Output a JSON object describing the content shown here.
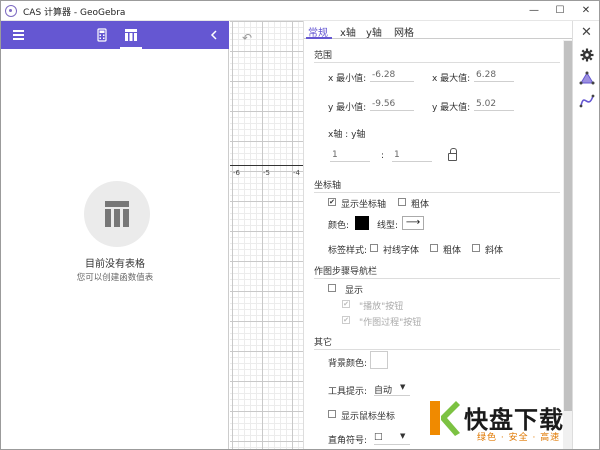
{
  "window": {
    "title": "CAS 计算器 - GeoGebra",
    "minimize_glyph": "—",
    "maximize_glyph": "☐",
    "close_glyph": "✕"
  },
  "left_toolbar": {
    "icons": [
      "menu-icon",
      "calculator-icon",
      "table-icon",
      "chevron-left-icon"
    ],
    "background_color": "#6557d2"
  },
  "table_view": {
    "empty_title": "目前没有表格",
    "empty_subtitle": "您可以创建函数值表"
  },
  "graphics": {
    "undo_glyph": "↶",
    "tick_labels": [
      "-6",
      "-5",
      "-4"
    ]
  },
  "settings": {
    "tabs": [
      "常规",
      "x轴",
      "y轴",
      "网格"
    ],
    "active_tab": "常规",
    "range": {
      "section": "范围",
      "xmin_label": "x 最小值:",
      "xmin_value": "-6.28",
      "xmax_label": "x 最大值:",
      "xmax_value": "6.28",
      "ymin_label": "y 最小值:",
      "ymin_value": "-9.56",
      "ymax_label": "y 最大值:",
      "ymax_value": "5.02",
      "ratio_label": "x轴 : y轴",
      "ratio_x": "1",
      "ratio_sep": ":",
      "ratio_y": "1"
    },
    "axes": {
      "section": "坐标轴",
      "show_axes_label": "显示坐标轴",
      "show_axes_checked": true,
      "bold_label": "粗体",
      "bold_checked": false,
      "color_label": "颜色:",
      "axis_color": "#000000",
      "linestyle_label": "线型:",
      "linestyle_glyph": "⟶",
      "label_style_label": "标签样式:",
      "serif_label": "衬线字体",
      "label_bold_label": "粗体",
      "italic_label": "斜体"
    },
    "navigation": {
      "section": "作图步骤导航栏",
      "show_label": "显示",
      "play_label": "\"播放\"按钮",
      "construction_label": "\"作图过程\"按钮"
    },
    "other": {
      "section": "其它",
      "bg_color_label": "背景颜色:",
      "tooltips_label": "工具提示:",
      "tooltips_value": "自动",
      "show_mouse_coords_label": "显示鼠标坐标",
      "right_angle_label": "直角符号:",
      "right_angle_value": "□"
    }
  },
  "right_rail": {
    "close_glyph": "✕",
    "icons": [
      "gear-icon",
      "graphics-style-icon",
      "algebra-curve-icon"
    ]
  },
  "watermark": {
    "brand_big": "快盘下载",
    "brand_small": "绿色 · 安全 · 高速"
  }
}
